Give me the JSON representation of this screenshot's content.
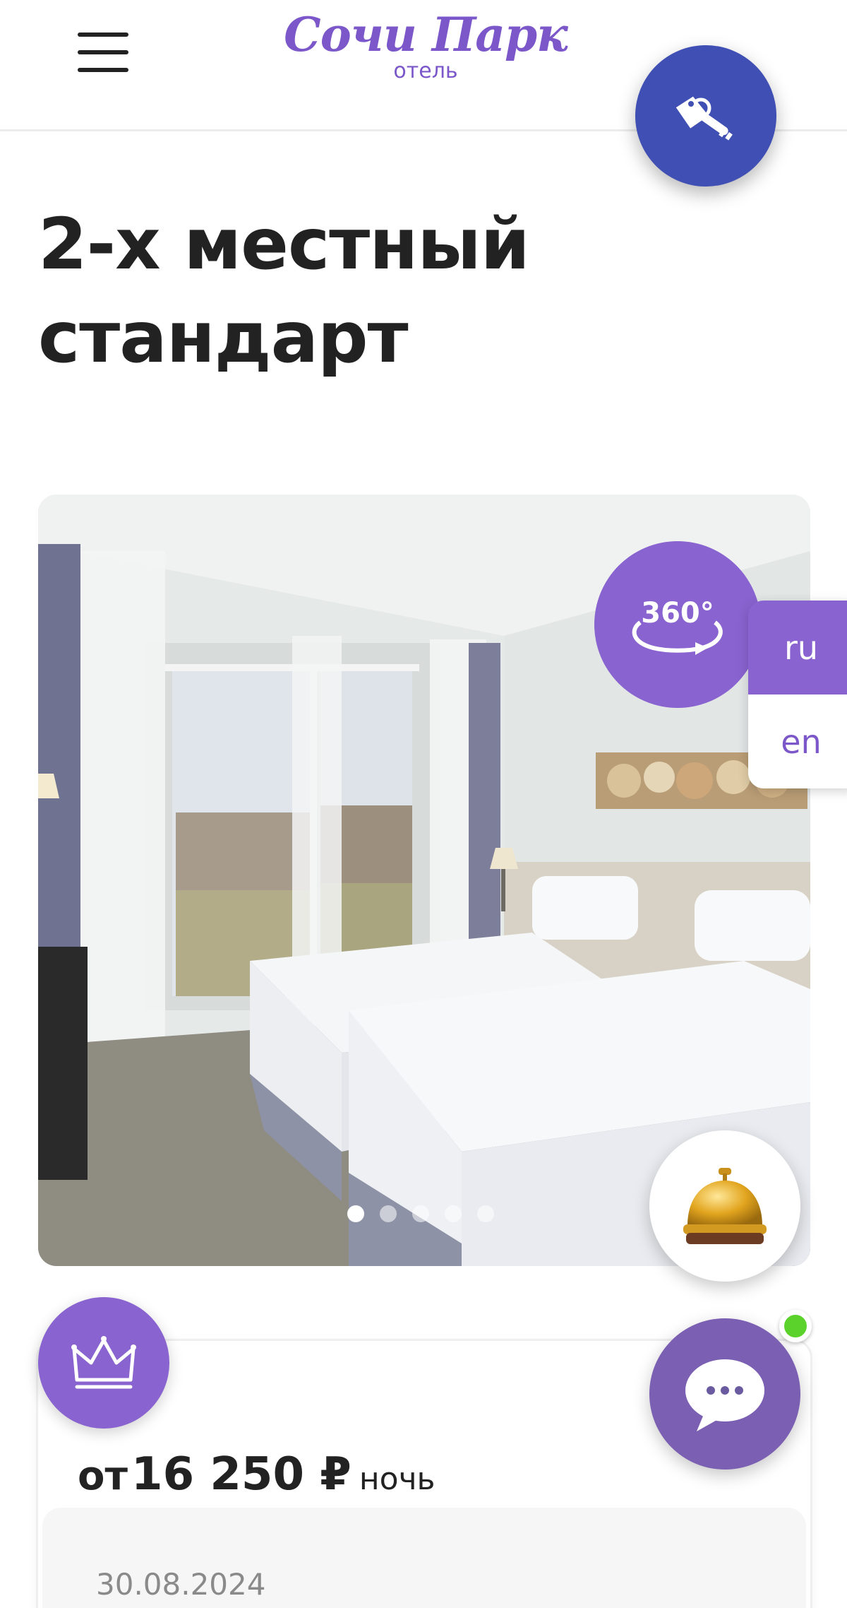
{
  "header": {
    "logo_name": "Сочи Парк",
    "logo_subtitle": "отель",
    "menu_icon": "hamburger-menu-icon",
    "key_icon": "room-key-icon"
  },
  "room": {
    "title_line1": "2-х местный",
    "title_line2": "стандарт"
  },
  "gallery": {
    "tour_label": "360°",
    "slide_count": 5,
    "active_slide": 1
  },
  "language": {
    "options": [
      "ru",
      "en"
    ],
    "selected": "ru"
  },
  "floating": {
    "bell_icon": "reception-bell-icon",
    "crown_icon": "crown-icon",
    "chat_icon": "chat-bubble-icon",
    "chat_status": "online"
  },
  "pricing": {
    "from_label": "от",
    "amount": "16 250 ₽",
    "per_label": "ночь",
    "date": "30.08.2024"
  },
  "colors": {
    "brand_purple": "#8963cf",
    "key_blue": "#3f4fb3",
    "online_green": "#5bd22b"
  }
}
